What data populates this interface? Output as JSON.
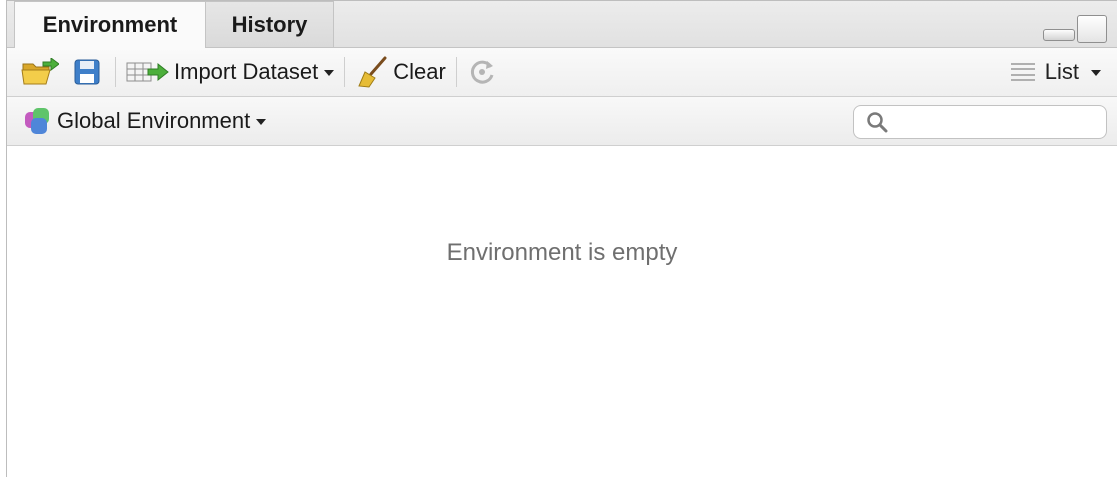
{
  "tabs": [
    {
      "label": "Environment",
      "active": true
    },
    {
      "label": "History",
      "active": false
    }
  ],
  "toolbar": {
    "load_icon": "folder-open-icon",
    "save_icon": "floppy-disk-icon",
    "import_label": "Import Dataset",
    "clear_label": "Clear",
    "refresh_icon": "refresh-icon",
    "view_label": "List"
  },
  "scope": {
    "label": "Global Environment"
  },
  "search": {
    "placeholder": "",
    "value": ""
  },
  "main": {
    "empty_message": "Environment is empty"
  },
  "colors": {
    "accent_green": "#4caf3b",
    "folder_yellow": "#f0c43a",
    "save_blue": "#3f7fc9"
  }
}
